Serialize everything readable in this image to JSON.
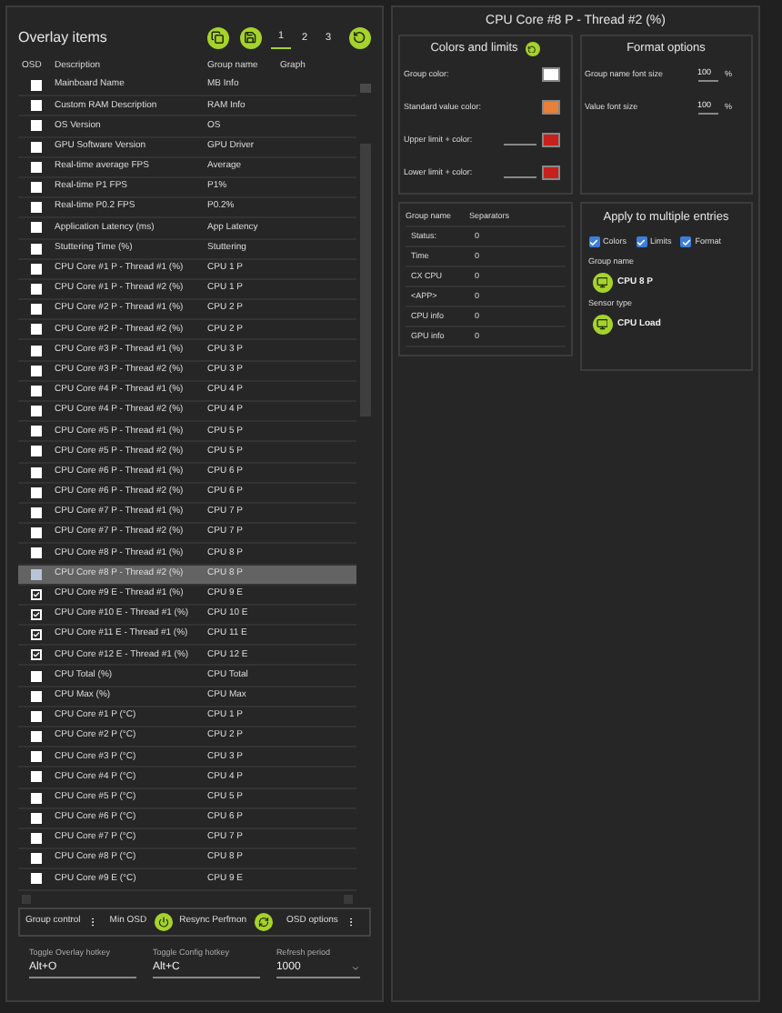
{
  "overlay": {
    "title": "Overlay items",
    "pages": [
      {
        "label": "1",
        "selected": true
      },
      {
        "label": "2",
        "selected": false
      },
      {
        "label": "3",
        "selected": false
      }
    ],
    "columns": [
      "OSD",
      "Description",
      "Group name",
      "Graph"
    ],
    "rows": [
      {
        "description": "Mainboard Name",
        "group": "MB Info",
        "osd": false,
        "selected": false
      },
      {
        "description": "Custom RAM Description",
        "group": "RAM Info",
        "osd": false,
        "selected": false
      },
      {
        "description": "OS Version",
        "group": "OS",
        "osd": false,
        "selected": false
      },
      {
        "description": "GPU Software Version",
        "group": "GPU Driver",
        "osd": false,
        "selected": false
      },
      {
        "description": "Real-time average FPS",
        "group": "Average",
        "osd": false,
        "selected": false
      },
      {
        "description": "Real-time P1 FPS",
        "group": "P1%",
        "osd": false,
        "selected": false
      },
      {
        "description": "Real-time P0.2 FPS",
        "group": "P0.2%",
        "osd": false,
        "selected": false
      },
      {
        "description": "Application Latency (ms)",
        "group": "App Latency",
        "osd": false,
        "selected": false
      },
      {
        "description": "Stuttering Time (%)",
        "group": "Stuttering",
        "osd": false,
        "selected": false
      },
      {
        "description": "CPU Core #1 P - Thread #1 (%)",
        "group": "CPU 1 P",
        "osd": false,
        "selected": false
      },
      {
        "description": "CPU Core #1 P - Thread #2 (%)",
        "group": "CPU 1 P",
        "osd": false,
        "selected": false
      },
      {
        "description": "CPU Core #2 P - Thread #1 (%)",
        "group": "CPU 2 P",
        "osd": false,
        "selected": false
      },
      {
        "description": "CPU Core #2 P - Thread #2 (%)",
        "group": "CPU 2 P",
        "osd": false,
        "selected": false
      },
      {
        "description": "CPU Core #3 P - Thread #1 (%)",
        "group": "CPU 3 P",
        "osd": false,
        "selected": false
      },
      {
        "description": "CPU Core #3 P - Thread #2 (%)",
        "group": "CPU 3 P",
        "osd": false,
        "selected": false
      },
      {
        "description": "CPU Core #4 P - Thread #1 (%)",
        "group": "CPU 4 P",
        "osd": false,
        "selected": false
      },
      {
        "description": "CPU Core #4 P - Thread #2 (%)",
        "group": "CPU 4 P",
        "osd": false,
        "selected": false
      },
      {
        "description": "CPU Core #5 P - Thread #1 (%)",
        "group": "CPU 5 P",
        "osd": false,
        "selected": false
      },
      {
        "description": "CPU Core #5 P - Thread #2 (%)",
        "group": "CPU 5 P",
        "osd": false,
        "selected": false
      },
      {
        "description": "CPU Core #6 P - Thread #1 (%)",
        "group": "CPU 6 P",
        "osd": false,
        "selected": false
      },
      {
        "description": "CPU Core #6 P - Thread #2 (%)",
        "group": "CPU 6 P",
        "osd": false,
        "selected": false
      },
      {
        "description": "CPU Core #7 P - Thread #1 (%)",
        "group": "CPU 7 P",
        "osd": false,
        "selected": false
      },
      {
        "description": "CPU Core #7 P - Thread #2 (%)",
        "group": "CPU 7 P",
        "osd": false,
        "selected": false
      },
      {
        "description": "CPU Core #8 P - Thread #1 (%)",
        "group": "CPU 8 P",
        "osd": false,
        "selected": false
      },
      {
        "description": "CPU Core #8 P - Thread #2 (%)",
        "group": "CPU 8 P",
        "osd": false,
        "selected": true
      },
      {
        "description": "CPU Core #9 E - Thread #1 (%)",
        "group": "CPU 9 E",
        "osd": true,
        "selected": false
      },
      {
        "description": "CPU Core #10 E - Thread #1 (%)",
        "group": "CPU 10 E",
        "osd": true,
        "selected": false
      },
      {
        "description": "CPU Core #11 E - Thread #1 (%)",
        "group": "CPU 11 E",
        "osd": true,
        "selected": false
      },
      {
        "description": "CPU Core #12 E - Thread #1 (%)",
        "group": "CPU 12 E",
        "osd": true,
        "selected": false
      },
      {
        "description": "CPU Total (%)",
        "group": "CPU Total",
        "osd": false,
        "selected": false
      },
      {
        "description": "CPU Max (%)",
        "group": "CPU Max",
        "osd": false,
        "selected": false
      },
      {
        "description": "CPU Core #1 P (°C)",
        "group": "CPU 1 P",
        "osd": false,
        "selected": false
      },
      {
        "description": "CPU Core #2 P (°C)",
        "group": "CPU 2 P",
        "osd": false,
        "selected": false
      },
      {
        "description": "CPU Core #3 P (°C)",
        "group": "CPU 3 P",
        "osd": false,
        "selected": false
      },
      {
        "description": "CPU Core #4 P (°C)",
        "group": "CPU 4 P",
        "osd": false,
        "selected": false
      },
      {
        "description": "CPU Core #5 P (°C)",
        "group": "CPU 5 P",
        "osd": false,
        "selected": false
      },
      {
        "description": "CPU Core #6 P (°C)",
        "group": "CPU 6 P",
        "osd": false,
        "selected": false
      },
      {
        "description": "CPU Core #7 P (°C)",
        "group": "CPU 7 P",
        "osd": false,
        "selected": false
      },
      {
        "description": "CPU Core #8 P (°C)",
        "group": "CPU 8 P",
        "osd": false,
        "selected": false
      },
      {
        "description": "CPU Core #9 E (°C)",
        "group": "CPU 9 E",
        "osd": false,
        "selected": false
      }
    ],
    "group_control": {
      "label": "Group control",
      "min_osd": "Min OSD",
      "resync": "Resync Perfmon",
      "osd_options": "OSD options"
    },
    "fields": [
      {
        "label": "Toggle Overlay hotkey",
        "value": "Alt+O",
        "kind": "text"
      },
      {
        "label": "Toggle Config hotkey",
        "value": "Alt+C",
        "kind": "text"
      },
      {
        "label": "Refresh period",
        "value": "1000",
        "kind": "select"
      }
    ]
  },
  "detail": {
    "title": "CPU Core #8 P - Thread #2 (%)",
    "colors": {
      "title": "Colors and limits",
      "rows": [
        {
          "label": "Group color:",
          "kind": "color",
          "color": "#ffffff"
        },
        {
          "label": "Standard value color:",
          "kind": "color",
          "color": "#e8803a"
        },
        {
          "label": "Upper limit + color:",
          "kind": "limit",
          "color": "#c8201c"
        },
        {
          "label": "Lower limit + color:",
          "kind": "limit",
          "color": "#c8201c"
        }
      ]
    },
    "format": {
      "title": "Format options",
      "rows": [
        {
          "label": "Group name font size",
          "value": "100",
          "unit": "%"
        },
        {
          "label": "Value font size",
          "value": "100",
          "unit": "%"
        }
      ]
    },
    "groups": {
      "columns": [
        "Group name",
        "Separators"
      ],
      "rows": [
        {
          "name": "Status:",
          "value": "0"
        },
        {
          "name": "Time",
          "value": "0"
        },
        {
          "name": "CX CPU",
          "value": "0"
        },
        {
          "name": "<APP>",
          "value": "0"
        },
        {
          "name": "CPU info",
          "value": "0"
        },
        {
          "name": "GPU info",
          "value": "0"
        }
      ]
    },
    "apply": {
      "title": "Apply to multiple entries",
      "options": [
        {
          "label": "Colors",
          "checked": true
        },
        {
          "label": "Limits",
          "checked": true
        },
        {
          "label": "Format",
          "checked": true
        }
      ],
      "group_label": "Group name",
      "group_value": "CPU 8 P",
      "sensor_label": "Sensor type",
      "sensor_value": "CPU Load"
    }
  }
}
